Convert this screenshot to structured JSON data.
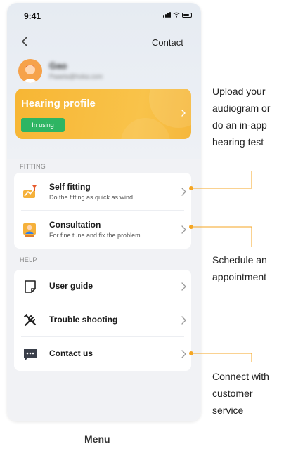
{
  "status_bar": {
    "time": "9:41"
  },
  "nav": {
    "back_icon": "chevron-left-icon",
    "contact_label": "Contact"
  },
  "profile": {
    "name": "Gao",
    "email": "Paaela@hoka.com",
    "avatar_icon": "user-avatar"
  },
  "hearing_card": {
    "title": "Hearing profile",
    "badge": "In using",
    "chevron_icon": "chevron-right-icon"
  },
  "fitting": {
    "label": "FITTING",
    "items": [
      {
        "title": "Self fitting",
        "subtitle": "Do the fitting as quick as wind",
        "icon": "self-fitting-icon"
      },
      {
        "title": "Consultation",
        "subtitle": "For fine tune and fix the problem",
        "icon": "consultation-icon"
      }
    ]
  },
  "help": {
    "label": "HELP",
    "items": [
      {
        "title": "User guide",
        "icon": "document-icon"
      },
      {
        "title": "Trouble shooting",
        "icon": "wrench-icon"
      },
      {
        "title": "Contact us",
        "icon": "chat-icon"
      }
    ]
  },
  "annotations": {
    "upload": [
      "Upload your",
      "audiogram or",
      "do an in-app",
      "hearing test"
    ],
    "schedule": [
      "Schedule an",
      "appointment"
    ],
    "connect": [
      "Connect with",
      "customer",
      "service"
    ]
  },
  "footer": {
    "caption": "Menu"
  },
  "colors": {
    "accent": "#f5a623",
    "card": "#f7b634",
    "badge": "#2eb563",
    "background": "#f1f2f5"
  }
}
